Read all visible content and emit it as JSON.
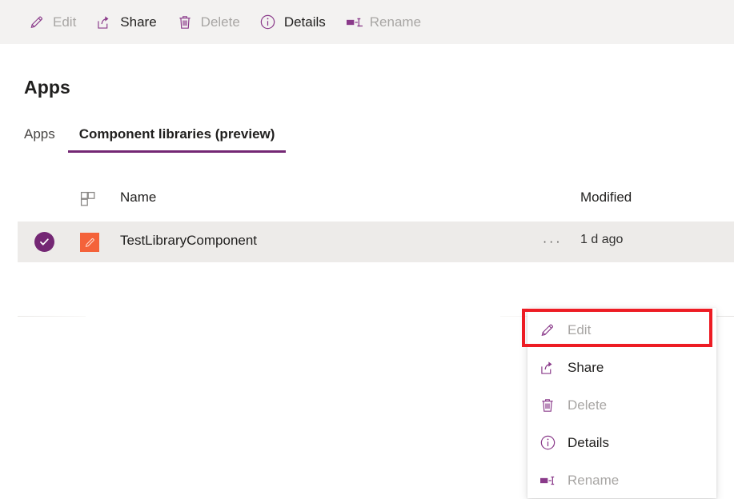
{
  "command_bar": {
    "items": [
      {
        "label": "Edit",
        "icon": "pencil-icon",
        "enabled": false
      },
      {
        "label": "Share",
        "icon": "share-icon",
        "enabled": true
      },
      {
        "label": "Delete",
        "icon": "trash-icon",
        "enabled": false
      },
      {
        "label": "Details",
        "icon": "info-icon",
        "enabled": true
      },
      {
        "label": "Rename",
        "icon": "rename-icon",
        "enabled": false
      }
    ]
  },
  "page": {
    "title": "Apps",
    "tabs": [
      {
        "label": "Apps",
        "active": false
      },
      {
        "label": "Component libraries (preview)",
        "active": true
      }
    ]
  },
  "list": {
    "columns": {
      "icon": "component-grid-icon",
      "name": "Name",
      "modified": "Modified"
    },
    "rows": [
      {
        "selected": true,
        "check_icon": "check-circle-icon",
        "app_icon": "pencil-app-tile-icon",
        "name": "TestLibraryComponent",
        "more_icon": "ellipsis-icon",
        "more_label": "···",
        "modified": "1 d ago"
      }
    ]
  },
  "context_menu": {
    "items": [
      {
        "label": "Edit",
        "icon": "pencil-icon",
        "enabled": false,
        "highlighted": true
      },
      {
        "label": "Share",
        "icon": "share-icon",
        "enabled": true,
        "highlighted": false
      },
      {
        "label": "Delete",
        "icon": "trash-icon",
        "enabled": false,
        "highlighted": false
      },
      {
        "label": "Details",
        "icon": "info-icon",
        "enabled": true,
        "highlighted": false
      },
      {
        "label": "Rename",
        "icon": "rename-icon",
        "enabled": false,
        "highlighted": false
      }
    ]
  },
  "colors": {
    "accent_purple": "#742774",
    "icon_purple": "#8a3a8a",
    "app_tile_orange": "#f4623a",
    "highlight_red": "#ed1c24",
    "row_selected_bg": "#edebe9",
    "command_bar_bg": "#f3f2f1",
    "disabled_text": "#a8a6a4",
    "primary_text": "#201f1e"
  }
}
